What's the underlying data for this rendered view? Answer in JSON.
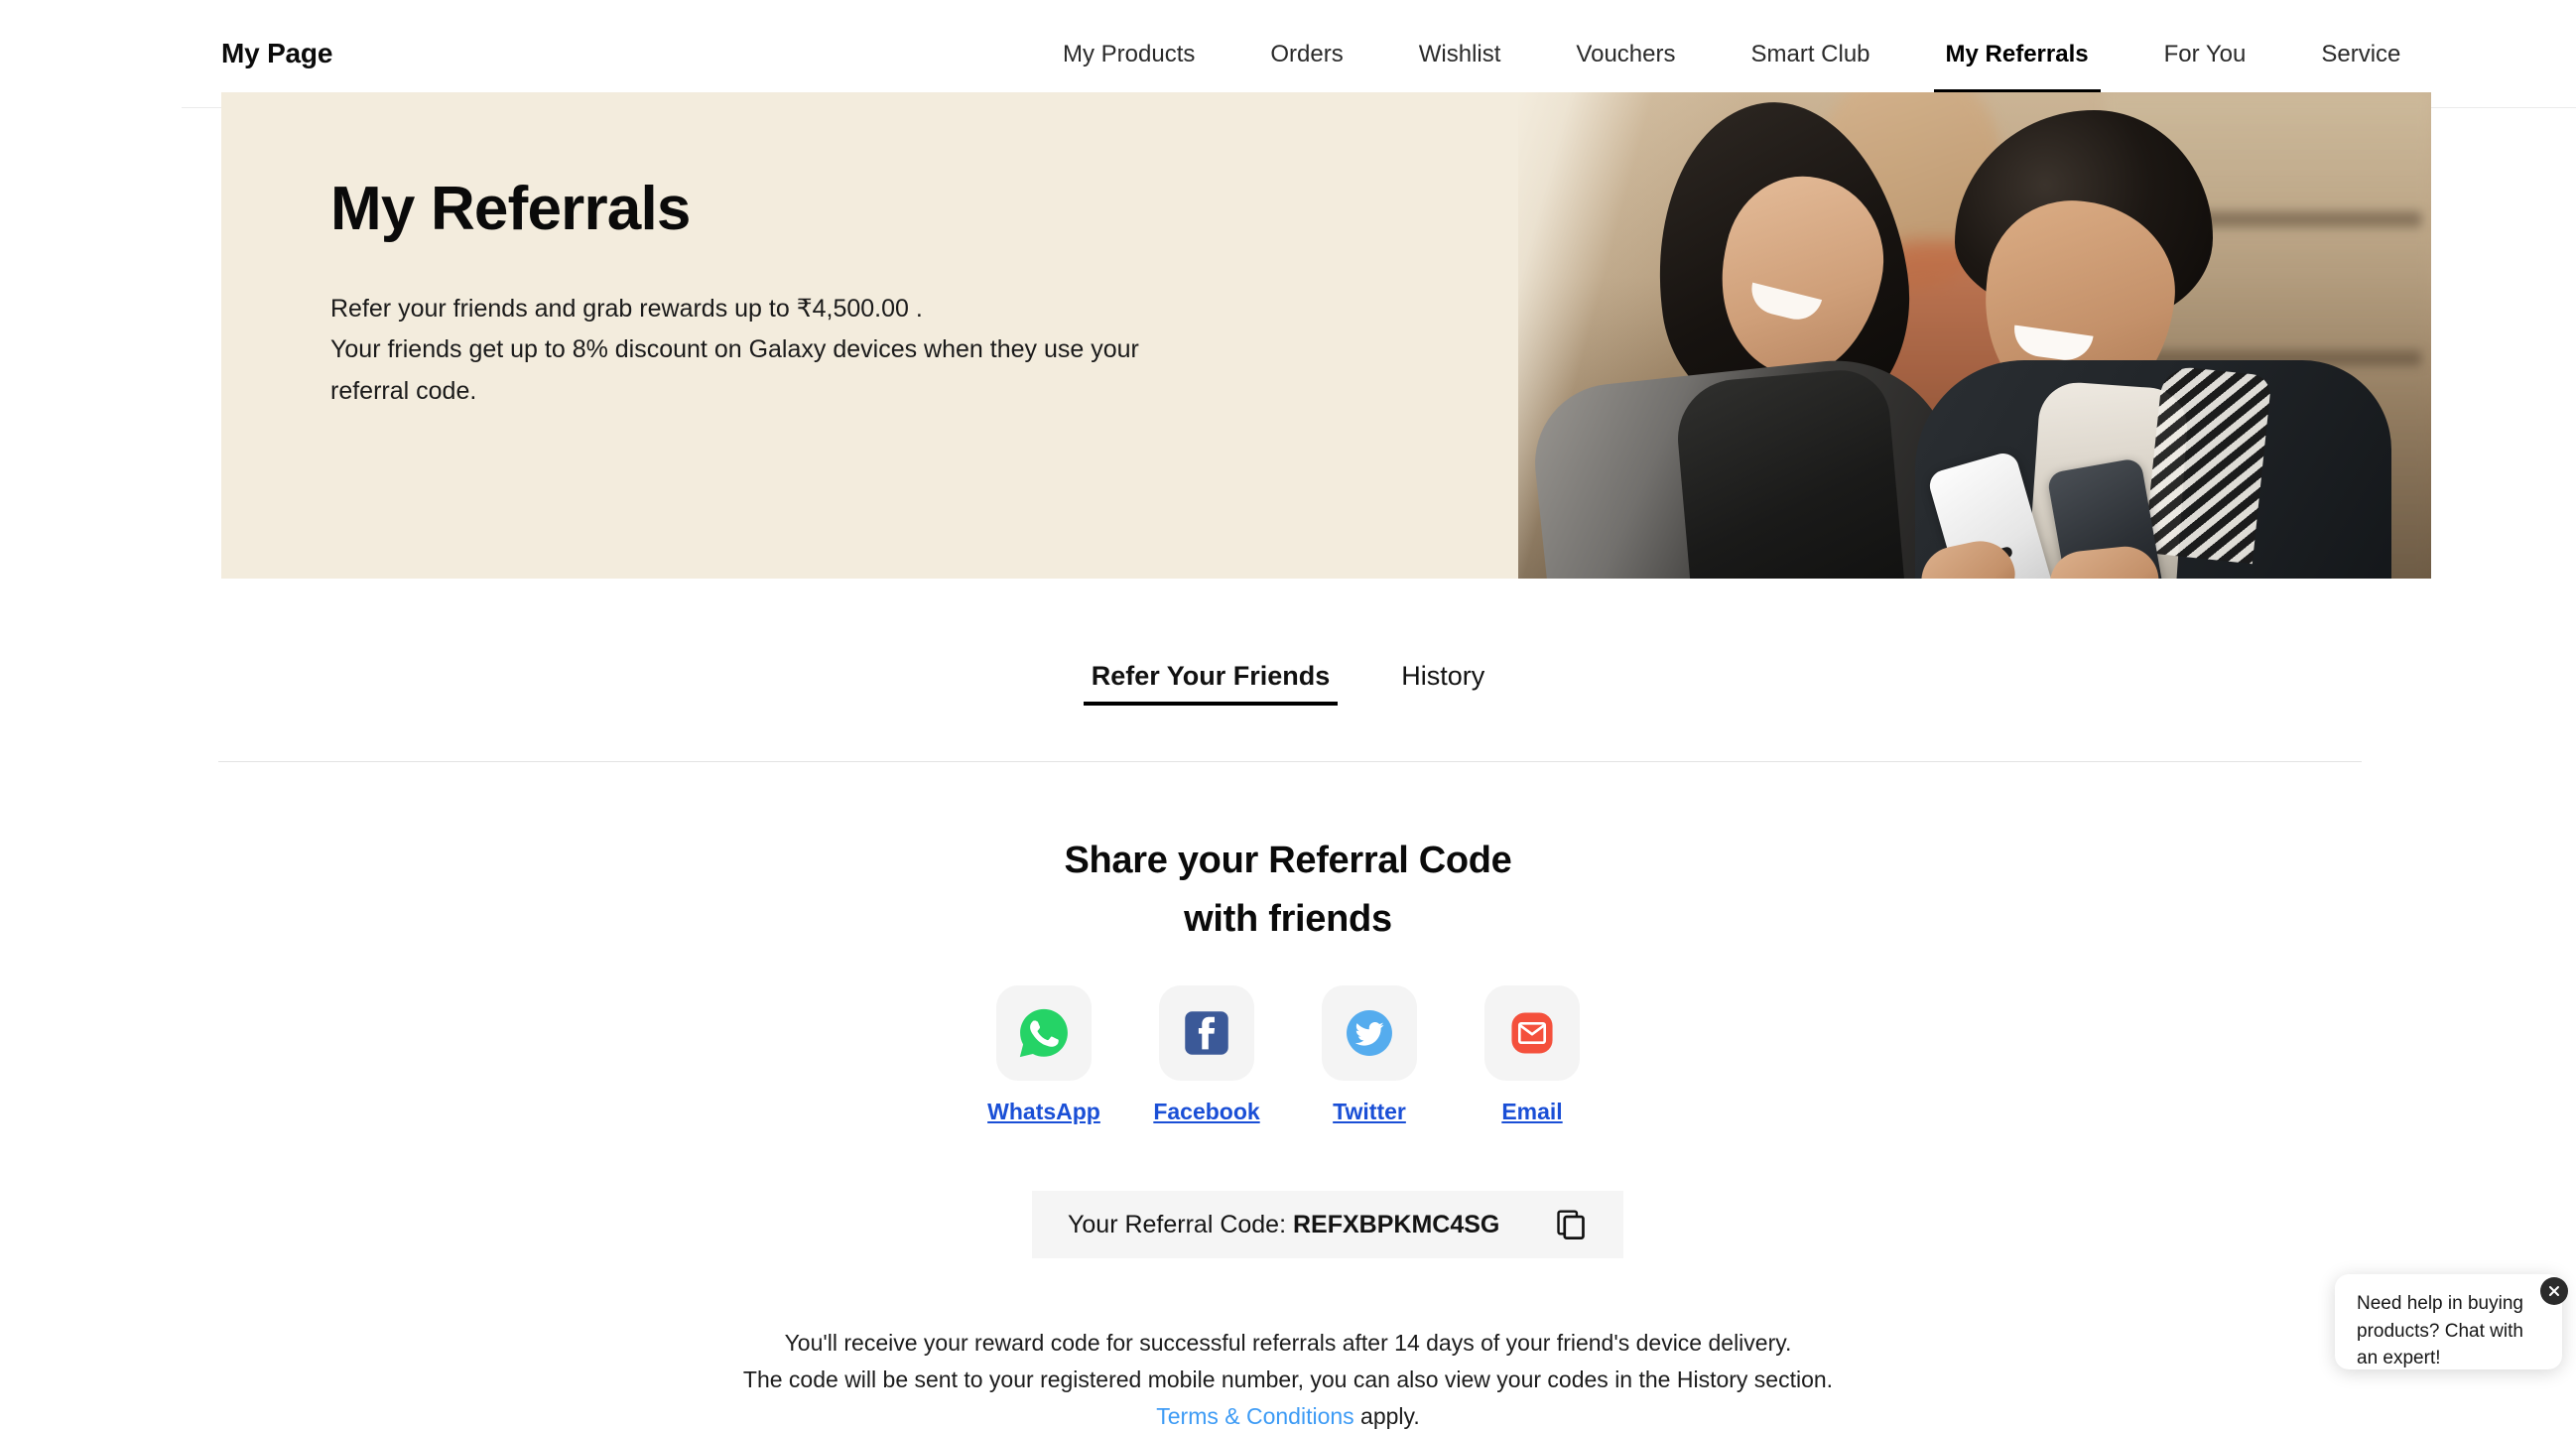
{
  "header": {
    "brand": "My Page",
    "nav_items": [
      {
        "label": "My Products",
        "active": false
      },
      {
        "label": "Orders",
        "active": false
      },
      {
        "label": "Wishlist",
        "active": false
      },
      {
        "label": "Vouchers",
        "active": false
      },
      {
        "label": "Smart Club",
        "active": false
      },
      {
        "label": "My Referrals",
        "active": true
      },
      {
        "label": "For You",
        "active": false
      },
      {
        "label": "Service",
        "active": false
      }
    ]
  },
  "hero": {
    "title": "My Referrals",
    "subtitle_line1": "Refer your friends and grab rewards up to ₹4,500.00 .",
    "subtitle_line2": "Your friends get up to 8% discount on Galaxy devices when they use your",
    "subtitle_line3": "referral code.",
    "background_color": "#f3ecdd"
  },
  "tabs": [
    {
      "label": "Refer Your Friends",
      "active": true
    },
    {
      "label": "History",
      "active": false
    }
  ],
  "share": {
    "title_line1": "Share your Referral Code",
    "title_line2": "with friends",
    "channels": [
      {
        "label": "WhatsApp",
        "icon": "whatsapp-icon",
        "color": "#25D366"
      },
      {
        "label": "Facebook",
        "icon": "facebook-icon",
        "color": "#3b5998"
      },
      {
        "label": "Twitter",
        "icon": "twitter-icon",
        "color": "#55acee"
      },
      {
        "label": "Email",
        "icon": "email-icon",
        "color": "#f4503c"
      }
    ],
    "link_color": "#1a4fd6"
  },
  "referral_code": {
    "label": "Your Referral Code:",
    "code": "REFXBPKMC4SG",
    "copy_icon": "copy-icon"
  },
  "note": {
    "line1": "You'll receive your reward code for successful referrals after 14 days of your friend's device delivery.",
    "line2": "The code will be sent to your registered mobile number, you can also view your codes in the History section.",
    "link": "Terms & Conditions",
    "line3_suffix": " apply.",
    "link_color": "#3d9bf5"
  },
  "chat_widget": {
    "message": "Need help in buying products? Chat with an expert!",
    "close_icon": "close-icon"
  }
}
